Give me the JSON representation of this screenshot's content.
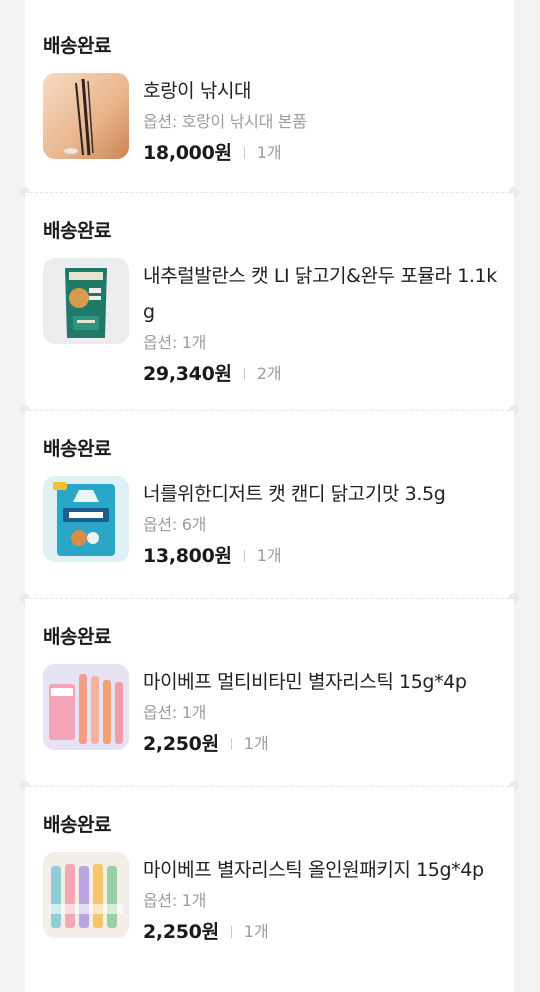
{
  "orders": [
    {
      "status": "배송완료",
      "name": "호랑이 낚시대",
      "option": "옵션: 호랑이 낚시대 본품",
      "price": "18,000원",
      "qty": "1개",
      "thumb_icon": "fishing-rod-image"
    },
    {
      "status": "배송완료",
      "name": "내추럴발란스 캣 LI 닭고기&완두 포뮬라 1.1kg",
      "option": "옵션: 1개",
      "price": "29,340원",
      "qty": "2개",
      "thumb_icon": "cat-food-bag-image"
    },
    {
      "status": "배송완료",
      "name": "너를위한디저트 캣 캔디 닭고기맛 3.5g",
      "option": "옵션: 6개",
      "price": "13,800원",
      "qty": "1개",
      "thumb_icon": "cat-candy-pack-image"
    },
    {
      "status": "배송완료",
      "name": "마이베프 멀티비타민 별자리스틱 15g*4p",
      "option": "옵션: 1개",
      "price": "2,250원",
      "qty": "1개",
      "thumb_icon": "cat-stick-snack-image"
    },
    {
      "status": "배송완료",
      "name": "마이베프 별자리스틱 올인원패키지 15g*4p",
      "option": "옵션: 1개",
      "price": "2,250원",
      "qty": "1개",
      "thumb_icon": "cat-stick-package-image"
    }
  ]
}
